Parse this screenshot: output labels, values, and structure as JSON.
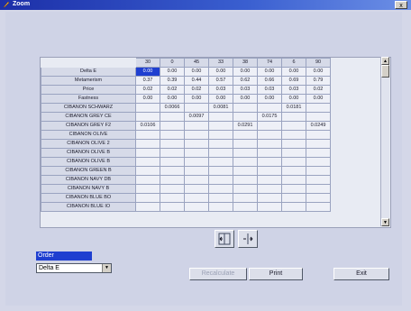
{
  "window": {
    "title": "Zoom",
    "close_label": "x"
  },
  "grid": {
    "columns": [
      "30",
      "0",
      "45",
      "33",
      "38",
      "74",
      "6",
      "90"
    ],
    "rows": [
      {
        "label": "Delta E",
        "cells": [
          "0.00",
          "0.00",
          "0.00",
          "0.00",
          "0.00",
          "0.00",
          "0.00",
          "0.00"
        ]
      },
      {
        "label": "Metamerism",
        "cells": [
          "0.37",
          "0.39",
          "0.44",
          "0.57",
          "0.62",
          "0.66",
          "0.69",
          "0.79"
        ]
      },
      {
        "label": "Price",
        "cells": [
          "0.02",
          "0.02",
          "0.02",
          "0.03",
          "0.03",
          "0.03",
          "0.03",
          "0.02"
        ]
      },
      {
        "label": "Fastness",
        "cells": [
          "0.00",
          "0.00",
          "0.00",
          "0.00",
          "0.00",
          "0.00",
          "0.00",
          "0.00"
        ]
      },
      {
        "label": "CIBANON SCHWARZ",
        "cells": [
          "",
          "0.0066",
          "",
          "0.0081",
          "",
          "",
          "0.0181",
          ""
        ]
      },
      {
        "label": "CIBANON GREY CE",
        "cells": [
          "",
          "",
          "0.0097",
          "",
          "",
          "0.0175",
          "",
          ""
        ]
      },
      {
        "label": "CIBANON GREY F2",
        "cells": [
          "0.0106",
          "",
          "",
          "",
          "0.0291",
          "",
          "",
          "0.0249"
        ]
      },
      {
        "label": "CIBANON OLIVE",
        "cells": [
          "",
          "",
          "",
          "",
          "",
          "",
          "",
          ""
        ]
      },
      {
        "label": "CIBANON OLIVE 2",
        "cells": [
          "",
          "",
          "",
          "",
          "",
          "",
          "",
          ""
        ]
      },
      {
        "label": "CIBANON OLIVE B",
        "cells": [
          "",
          "",
          "",
          "",
          "",
          "",
          "",
          ""
        ]
      },
      {
        "label": "CIBANON OLIVE B",
        "cells": [
          "",
          "",
          "",
          "",
          "",
          "",
          "",
          ""
        ]
      },
      {
        "label": "CIBANON GREEN B",
        "cells": [
          "",
          "",
          "",
          "",
          "",
          "",
          "",
          ""
        ]
      },
      {
        "label": "CIBANON NAVY DB",
        "cells": [
          "",
          "",
          "",
          "",
          "",
          "",
          "",
          ""
        ]
      },
      {
        "label": "CIBANON NAVY B",
        "cells": [
          "",
          "",
          "",
          "",
          "",
          "",
          "",
          ""
        ]
      },
      {
        "label": "CIBANON BLUE BO",
        "cells": [
          "",
          "",
          "",
          "",
          "",
          "",
          "",
          ""
        ]
      },
      {
        "label": "CIBANON BLUE IO",
        "cells": [
          "",
          "",
          "",
          "",
          "",
          "",
          "",
          ""
        ]
      }
    ],
    "selected_cell": {
      "row": 0,
      "col": 0
    }
  },
  "order": {
    "label": "Order",
    "value": "Delta E"
  },
  "buttons": {
    "recalculate": "Recalculate",
    "print": "Print",
    "exit": "Exit"
  },
  "icons": {
    "nav_left": "collapse-left-icon",
    "nav_right": "expand-right-icon"
  },
  "colors": {
    "accent": "#1f3fd0",
    "titlebar": "#1c2fa8",
    "background": "#cfd3e6"
  }
}
